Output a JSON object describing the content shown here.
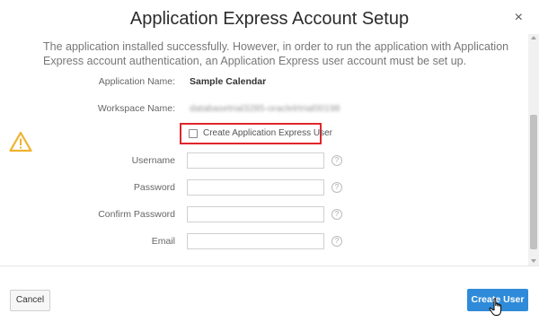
{
  "dialog": {
    "title": "Application Express Account Setup",
    "close_label": "×"
  },
  "intro": {
    "text": "The application installed successfully. However, in order to run the application with Application Express account authentication, an Application Express user account must be set up."
  },
  "fields": {
    "application_name_label": "Application Name:",
    "application_name_value": "Sample Calendar",
    "workspace_name_label": "Workspace Name:",
    "workspace_name_value": "databasetrial3285-oraclelrtrial00198",
    "create_user_checkbox_label": "Create Application Express User",
    "create_user_checked": false,
    "username_label": "Username",
    "password_label": "Password",
    "confirm_password_label": "Confirm Password",
    "email_label": "Email",
    "help_glyph": "?"
  },
  "footer": {
    "cancel_label": "Cancel",
    "create_user_label": "Create User"
  },
  "colors": {
    "accent_button": "#2f8bd9",
    "highlight_border": "#e0262b",
    "warning_icon": "#f0b22e"
  },
  "icons": {
    "warning": "warning-icon",
    "close": "close-icon",
    "help": "help-icon",
    "cursor": "hand-cursor-icon"
  }
}
